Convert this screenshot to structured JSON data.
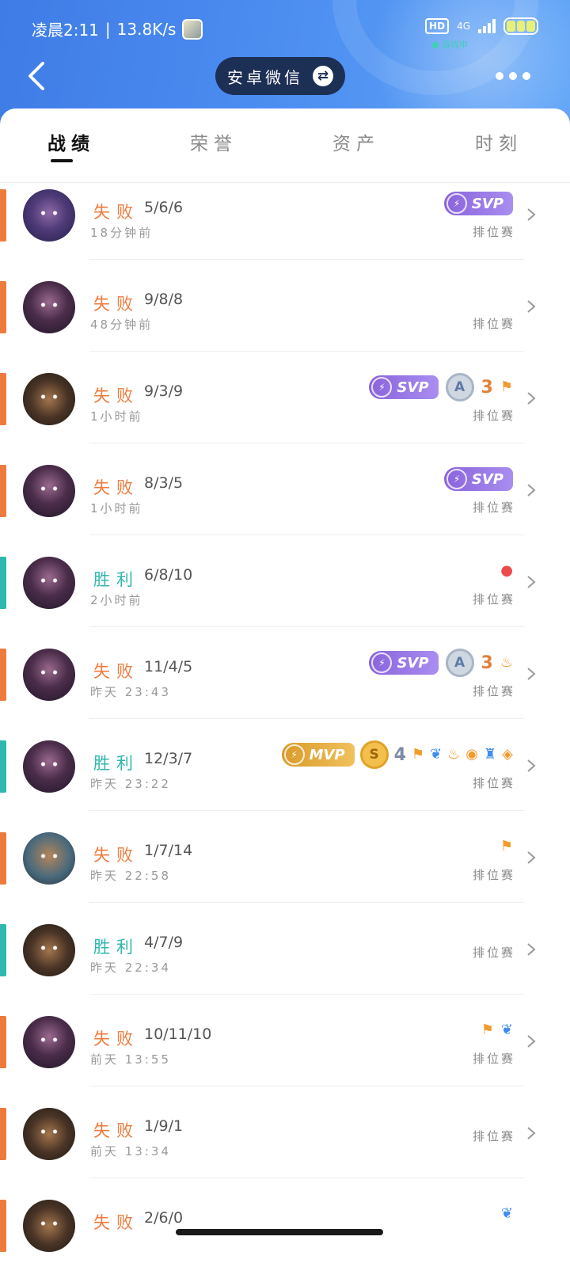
{
  "status_bar": {
    "time": "凌晨2:11",
    "speed": "13.8K/s",
    "hd": "HD",
    "net": "4G",
    "pulse": "● 游戏中"
  },
  "header": {
    "switch_label": "安卓微信",
    "switch_icon": "⇄"
  },
  "tabs": [
    {
      "label": "战绩",
      "active": true
    },
    {
      "label": "荣誉",
      "active": false
    },
    {
      "label": "资产",
      "active": false
    },
    {
      "label": "时刻",
      "active": false
    }
  ],
  "matches": [
    {
      "result": "失败",
      "kda": "5/6/6",
      "time": "18分钟前",
      "mode": "排位赛"
    },
    {
      "result": "失败",
      "kda": "9/8/8",
      "time": "48分钟前",
      "mode": "排位赛"
    },
    {
      "result": "失败",
      "kda": "9/3/9",
      "time": "1小时前",
      "mode": "排位赛"
    },
    {
      "result": "失败",
      "kda": "8/3/5",
      "time": "1小时前",
      "mode": "排位赛"
    },
    {
      "result": "胜利",
      "kda": "6/8/10",
      "time": "2小时前",
      "mode": "排位赛"
    },
    {
      "result": "失败",
      "kda": "11/4/5",
      "time": "昨天 23:43",
      "mode": "排位赛"
    },
    {
      "result": "胜利",
      "kda": "12/3/7",
      "time": "昨天 23:22",
      "mode": "排位赛"
    },
    {
      "result": "失败",
      "kda": "1/7/14",
      "time": "昨天 22:58",
      "mode": "排位赛"
    },
    {
      "result": "胜利",
      "kda": "4/7/9",
      "time": "昨天 22:34",
      "mode": "排位赛"
    },
    {
      "result": "失败",
      "kda": "10/11/10",
      "time": "前天 13:55",
      "mode": "排位赛"
    },
    {
      "result": "失败",
      "kda": "1/9/1",
      "time": "前天 13:34",
      "mode": "排位赛"
    },
    {
      "result": "失败",
      "kda": "2/6/0",
      "time": "",
      "mode": ""
    }
  ],
  "badge_text": {
    "svp": "SVP",
    "mvp": "MVP",
    "a": "A",
    "s": "S",
    "three": "3",
    "four": "4",
    "svp_icon": "⚡"
  },
  "colors": {
    "lose": "#ee7b3d",
    "win": "#2fb8ad",
    "header_blue": "#4b8cf0",
    "svp": "#8a63dc",
    "mvp": "#e3a83a"
  }
}
